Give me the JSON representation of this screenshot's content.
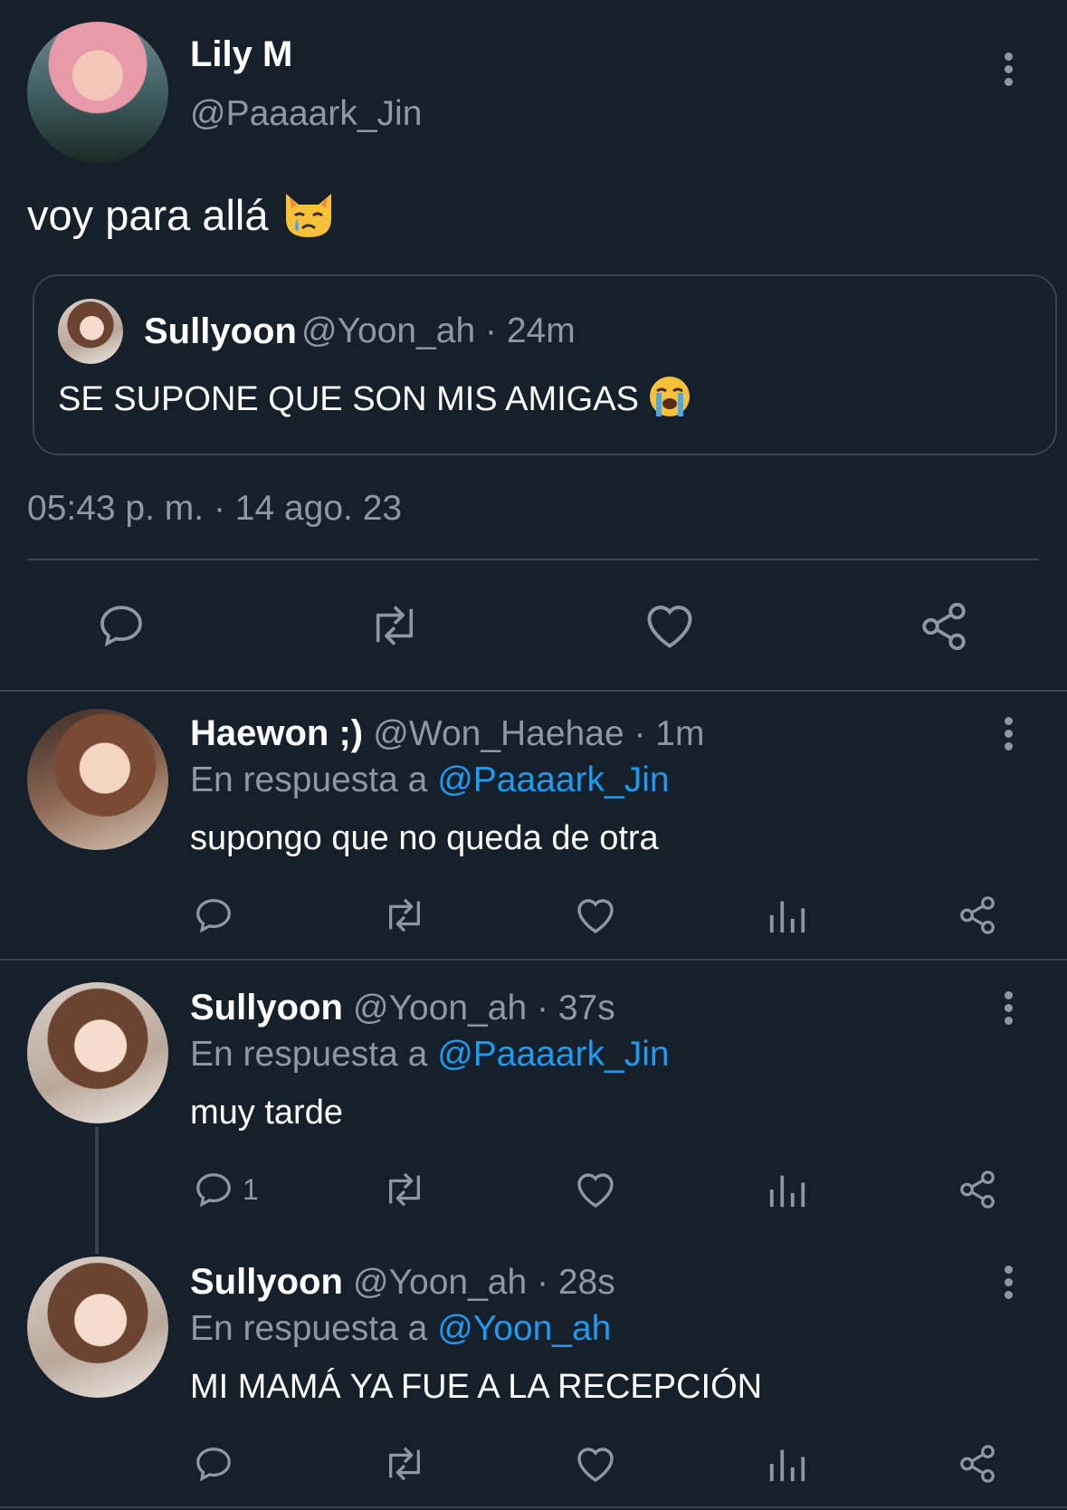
{
  "main_tweet": {
    "display_name": "Lily M",
    "handle": "@Paaaark_Jin",
    "text": "voy para allá",
    "emoji": "crying-cat-face",
    "timestamp": "05:43 p. m. · 14 ago. 23"
  },
  "quoted_tweet": {
    "display_name": "Sullyoon",
    "handle_time": "@Yoon_ah · 24m",
    "text": "SE SUPONE QUE SON MIS AMIGAS",
    "emoji": "loudly-crying-face"
  },
  "replies": [
    {
      "display_name": "Haewon ;)",
      "handle_time": "@Won_Haehae · 1m",
      "reply_prefix": "En respuesta a",
      "reply_to": "@Paaaark_Jin",
      "text": "supongo que no queda de otra",
      "reply_count": ""
    },
    {
      "display_name": "Sullyoon",
      "handle_time": "@Yoon_ah · 37s",
      "reply_prefix": "En respuesta a",
      "reply_to": "@Paaaark_Jin",
      "text": "muy tarde",
      "reply_count": "1"
    },
    {
      "display_name": "Sullyoon",
      "handle_time": "@Yoon_ah · 28s",
      "reply_prefix": "En respuesta a",
      "reply_to": "@Yoon_ah",
      "text": "MI MAMÁ YA FUE A LA RECEPCIÓN",
      "reply_count": ""
    }
  ],
  "icons": {
    "reply": "reply-bubble-icon",
    "retweet": "retweet-icon",
    "like": "heart-icon",
    "views": "analytics-icon",
    "share": "share-icon",
    "more": "more-vertical-icon"
  },
  "colors": {
    "background": "#15202b",
    "muted": "#8b98a5",
    "link": "#1d9bf0",
    "divider": "#38444d"
  }
}
